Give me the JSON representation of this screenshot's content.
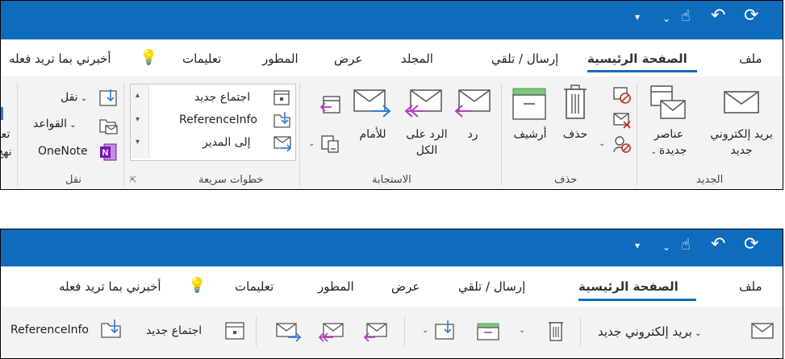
{
  "qat": {
    "icons": [
      "dropdown-arrow-icon",
      "touch-mode-icon",
      "undo-icon",
      "refresh-icon"
    ]
  },
  "tabs": {
    "file": "ملف",
    "home": "الصفحة الرئيسية",
    "send_receive": "إرسال / تلقي",
    "folder": "المجلد",
    "view": "عرض",
    "developer": "المطور",
    "help": "تعليمات",
    "tell_me": "أخبرني بما تريد فعله"
  },
  "new_group": {
    "label": "الجديد",
    "new_email_line1": "بريد إلكتروني",
    "new_email_line2": "جديد",
    "new_items_line1": "عناصر",
    "new_items_line2": "جديدة"
  },
  "delete_group": {
    "label": "حذف",
    "delete": "حذف",
    "archive": "أرشيف"
  },
  "respond_group": {
    "label": "الاستجابة",
    "reply": "رد",
    "reply_all_line1": "الرد على",
    "reply_all_line2": "الكل",
    "forward": "للأمام"
  },
  "quick_steps": {
    "label": "خطوات سريعة",
    "items": [
      "اجتماع جديد",
      "ReferenceInfo",
      "إلى المدير"
    ]
  },
  "move_group": {
    "label": "نقل",
    "move": "نقل",
    "rules": "القواعد",
    "onenote": "OneNote"
  },
  "partial": {
    "line1": "تعا",
    "line2": "نهج"
  },
  "simplified": {
    "new_email": "بريد إلكتروني جديد",
    "new_meeting": "اجتماع جديد",
    "reference_info": "ReferenceInfo"
  },
  "colors": {
    "accent": "#0f6cbd",
    "ribbon_bg": "#f3f3f3"
  }
}
